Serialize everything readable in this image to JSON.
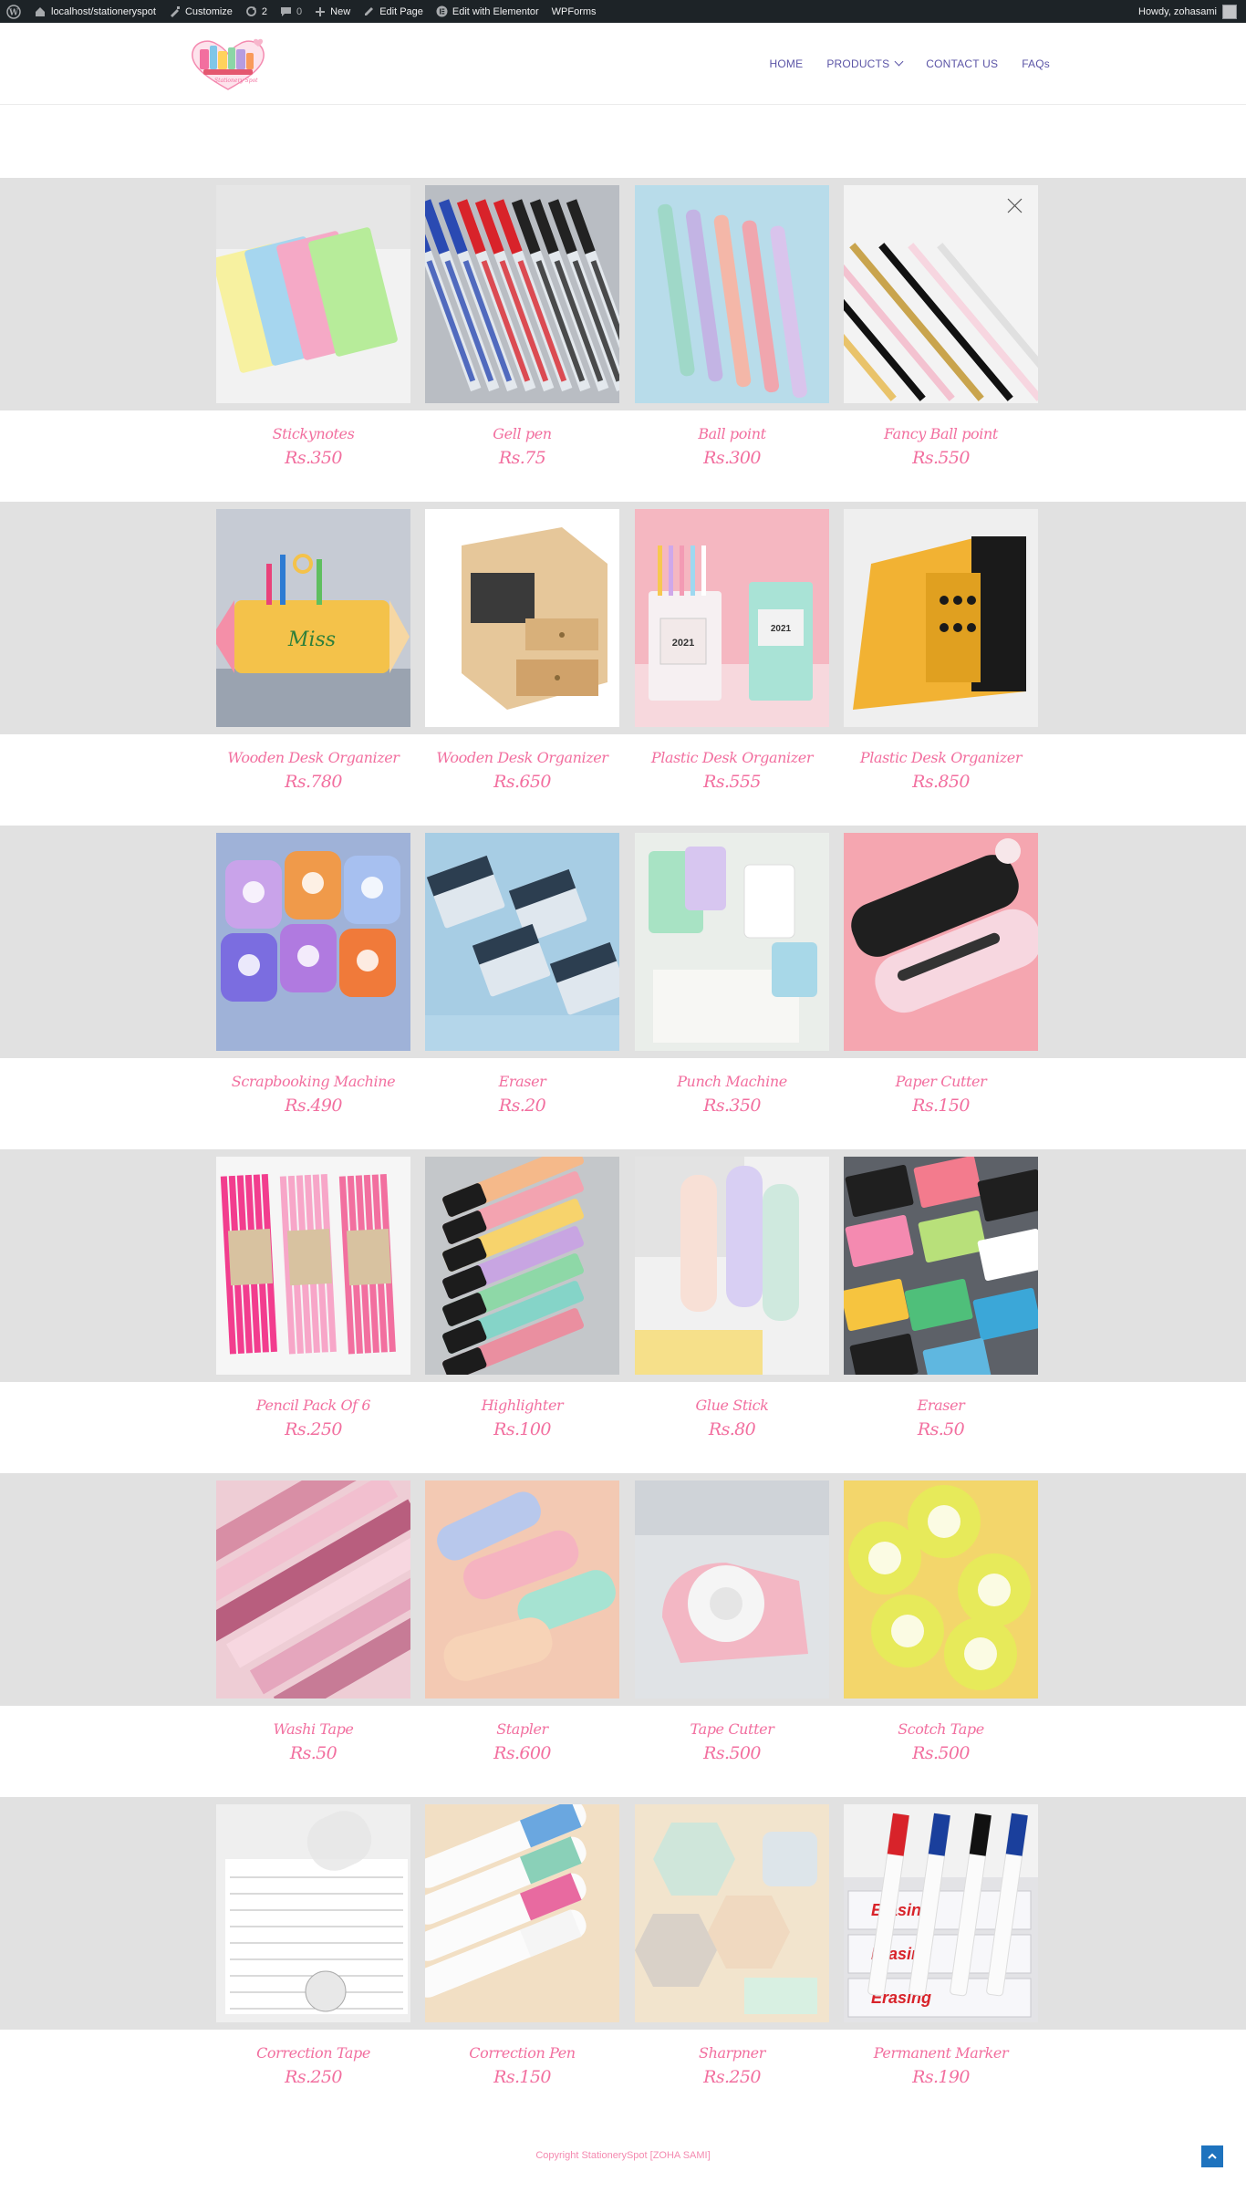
{
  "admin_bar": {
    "site": "localhost/stationeryspot",
    "customize": "Customize",
    "updates": "2",
    "comments": "0",
    "new": "New",
    "edit_page": "Edit Page",
    "elementor": "Edit with Elementor",
    "wpforms": "WPForms",
    "howdy": "Howdy, zohasami"
  },
  "logo": {
    "text": "Stationery Spot"
  },
  "nav": {
    "home": "HOME",
    "products": "PRODUCTS",
    "contact": "CONTACT US",
    "faqs": "FAQs"
  },
  "rows": [
    {
      "products": [
        {
          "name": "Stickynotes",
          "price": "Rs.350",
          "image": "sticky-notes"
        },
        {
          "name": "Gell pen",
          "price": "Rs.75",
          "image": "gel-pens"
        },
        {
          "name": "Ball point",
          "price": "Rs.300",
          "image": "pastel-pens"
        },
        {
          "name": "Fancy Ball point",
          "price": "Rs.550",
          "image": "fancy-pens"
        }
      ]
    },
    {
      "products": [
        {
          "name": "Wooden Desk Organizer",
          "price": "Rs.780",
          "image": "pencil-organizer"
        },
        {
          "name": "Wooden Desk Organizer",
          "price": "Rs.650",
          "image": "wooden-drawers"
        },
        {
          "name": "Plastic Desk Organizer",
          "price": "Rs.555",
          "image": "plastic-organizer"
        },
        {
          "name": "Plastic Desk Organizer",
          "price": "Rs.850",
          "image": "file-organizer"
        }
      ]
    },
    {
      "products": [
        {
          "name": "Scrapbooking Machine",
          "price": "Rs.490",
          "image": "punchers"
        },
        {
          "name": "Eraser",
          "price": "Rs.20",
          "image": "erasers-blue"
        },
        {
          "name": "Punch Machine",
          "price": "Rs.350",
          "image": "hole-punch"
        },
        {
          "name": "Paper Cutter",
          "price": "Rs.150",
          "image": "paper-cutter"
        }
      ]
    },
    {
      "products": [
        {
          "name": "Pencil Pack Of 6",
          "price": "Rs.250",
          "image": "pencils"
        },
        {
          "name": "Highlighter",
          "price": "Rs.100",
          "image": "highlighters"
        },
        {
          "name": "Glue Stick",
          "price": "Rs.80",
          "image": "glue-sticks"
        },
        {
          "name": "Eraser",
          "price": "Rs.50",
          "image": "erasers-color"
        }
      ]
    },
    {
      "products": [
        {
          "name": "Washi Tape",
          "price": "Rs.50",
          "image": "washi-tape"
        },
        {
          "name": "Stapler",
          "price": "Rs.600",
          "image": "staplers"
        },
        {
          "name": "Tape Cutter",
          "price": "Rs.500",
          "image": "tape-cutter"
        },
        {
          "name": "Scotch Tape",
          "price": "Rs.500",
          "image": "scotch-tape"
        }
      ]
    },
    {
      "products": [
        {
          "name": "Correction Tape",
          "price": "Rs.250",
          "image": "correction-tape"
        },
        {
          "name": "Correction Pen",
          "price": "Rs.150",
          "image": "correction-pen"
        },
        {
          "name": "Sharpner",
          "price": "Rs.250",
          "image": "sharpeners"
        },
        {
          "name": "Permanent Marker",
          "price": "Rs.190",
          "image": "markers"
        }
      ]
    }
  ],
  "footer": {
    "copyright": "Copyright StationerySpot [ZOHA SAMI]"
  }
}
